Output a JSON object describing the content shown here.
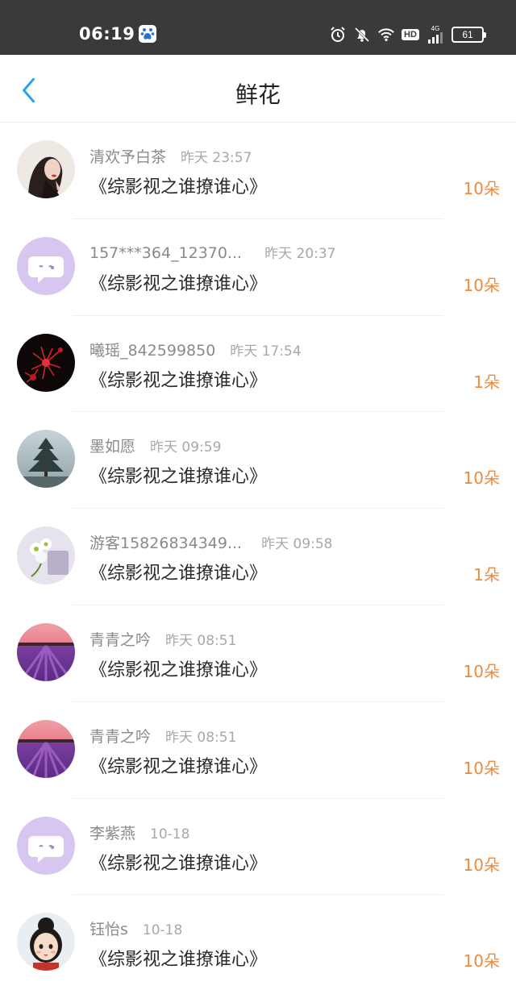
{
  "status_bar": {
    "time": "06:19",
    "battery": "61",
    "hd": "HD",
    "network": "4G",
    "icons": [
      "baidu-app-icon",
      "alarm-icon",
      "mute-icon",
      "wifi-icon",
      "hd-icon",
      "signal-icon",
      "battery-icon"
    ]
  },
  "header": {
    "title": "鲜花",
    "back_icon": "chevron-left-icon",
    "accent_color": "#2aa1e8"
  },
  "colors": {
    "amount": "#f08a3c",
    "username": "#8a8a8a",
    "time": "#a8a8a8",
    "status_bar_bg": "#3a3a3a"
  },
  "records": [
    {
      "user": "清欢予白茶",
      "time": "昨天 23:57",
      "book": "《综影视之谁撩谁心》",
      "amount": "10朵",
      "avatar": "woman-portrait-avatar"
    },
    {
      "user": "157***364_12370...",
      "time": "昨天 20:37",
      "book": "《综影视之谁撩谁心》",
      "amount": "10朵",
      "avatar": "default-chat-avatar"
    },
    {
      "user": "曦瑶_842599850",
      "time": "昨天 17:54",
      "book": "《综影视之谁撩谁心》",
      "amount": "1朵",
      "avatar": "red-flower-avatar"
    },
    {
      "user": "墨如愿",
      "time": "昨天 09:59",
      "book": "《综影视之谁撩谁心》",
      "amount": "10朵",
      "avatar": "pine-tree-avatar"
    },
    {
      "user": "游客15826834349...",
      "time": "昨天 09:58",
      "book": "《综影视之谁撩谁心》",
      "amount": "1朵",
      "avatar": "white-flowers-avatar"
    },
    {
      "user": "青青之吟",
      "time": "昨天 08:51",
      "book": "《综影视之谁撩谁心》",
      "amount": "10朵",
      "avatar": "lavender-field-avatar"
    },
    {
      "user": "青青之吟",
      "time": "昨天 08:51",
      "book": "《综影视之谁撩谁心》",
      "amount": "10朵",
      "avatar": "lavender-field-avatar"
    },
    {
      "user": "李紫燕",
      "time": "10-18",
      "book": "《综影视之谁撩谁心》",
      "amount": "10朵",
      "avatar": "default-chat-avatar"
    },
    {
      "user": "钰怡s",
      "time": "10-18",
      "book": "《综影视之谁撩谁心》",
      "amount": "10朵",
      "avatar": "cartoon-girl-avatar"
    }
  ]
}
